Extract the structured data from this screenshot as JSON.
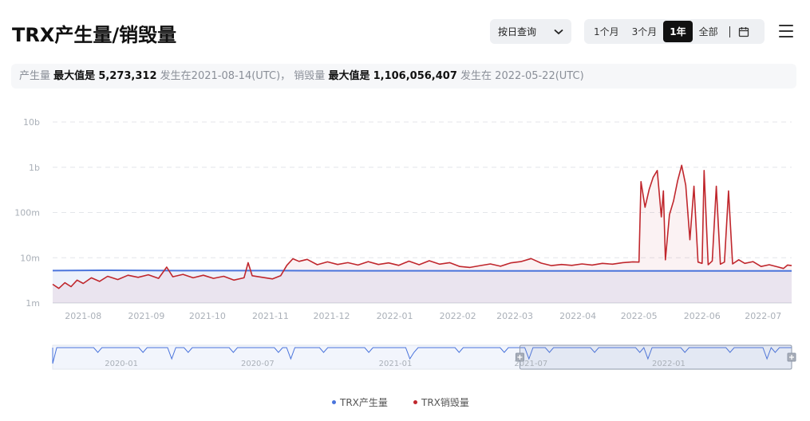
{
  "header": {
    "title": "TRX产生量/销毁量",
    "query_mode": "按日查询",
    "ranges": [
      "1个月",
      "3个月",
      "1年",
      "全部"
    ],
    "active_range": "1年"
  },
  "stats": {
    "prod_label": "产生量",
    "prod_max_label": "最大值是",
    "prod_max": "5,273,312",
    "prod_at": "发生在",
    "prod_date": "2021-08-14(UTC)，",
    "burn_label": "销毁量",
    "burn_max_label": "最大值是",
    "burn_max": "1,106,056,407",
    "burn_at": "发生在",
    "burn_date": "2022-05-22(UTC)"
  },
  "colors": {
    "production": "#4a74dc",
    "burn": "#c0272d",
    "grid": "#e4e6ea",
    "axis_text": "#aab0b8"
  },
  "chart_data": {
    "type": "line",
    "x_start": "2021-07-17",
    "x_end": "2022-07-15",
    "yscale": "log",
    "ylim": [
      1000000,
      10000000000
    ],
    "y_ticks": [
      {
        "value": 1000000,
        "label": "1m"
      },
      {
        "value": 10000000,
        "label": "10m"
      },
      {
        "value": 100000000,
        "label": "100m"
      },
      {
        "value": 1000000000,
        "label": "1b"
      },
      {
        "value": 10000000000,
        "label": "10b"
      }
    ],
    "x_ticks": [
      {
        "date": "2021-08-01",
        "label": "2021-08"
      },
      {
        "date": "2021-09-01",
        "label": "2021-09"
      },
      {
        "date": "2021-10-01",
        "label": "2021-10"
      },
      {
        "date": "2021-11-01",
        "label": "2021-11"
      },
      {
        "date": "2021-12-01",
        "label": "2021-12"
      },
      {
        "date": "2022-01-01",
        "label": "2022-01"
      },
      {
        "date": "2022-02-01",
        "label": "2022-02"
      },
      {
        "date": "2022-03-01",
        "label": "2022-03"
      },
      {
        "date": "2022-04-01",
        "label": "2022-04"
      },
      {
        "date": "2022-05-01",
        "label": "2022-05"
      },
      {
        "date": "2022-06-01",
        "label": "2022-06"
      },
      {
        "date": "2022-07-01",
        "label": "2022-07"
      }
    ],
    "grid": true,
    "legend_position": "bottom-center",
    "series": [
      {
        "name": "TRX产生量",
        "key": "production",
        "points": [
          [
            "2021-07-17",
            5200000
          ],
          [
            "2021-08-14",
            5273312
          ],
          [
            "2021-09-15",
            5200000
          ],
          [
            "2021-10-20",
            5200000
          ],
          [
            "2021-11-05",
            5200000
          ],
          [
            "2021-12-15",
            5150000
          ],
          [
            "2022-01-20",
            5150000
          ],
          [
            "2022-03-01",
            5100000
          ],
          [
            "2022-04-15",
            5100000
          ],
          [
            "2022-05-20",
            5100000
          ],
          [
            "2022-06-20",
            5100000
          ],
          [
            "2022-07-15",
            5100000
          ]
        ]
      },
      {
        "name": "TRX销毁量",
        "key": "burn",
        "points": [
          [
            "2021-07-17",
            2600000
          ],
          [
            "2021-07-20",
            2100000
          ],
          [
            "2021-07-23",
            2800000
          ],
          [
            "2021-07-26",
            2300000
          ],
          [
            "2021-07-29",
            3200000
          ],
          [
            "2021-08-01",
            2700000
          ],
          [
            "2021-08-05",
            3600000
          ],
          [
            "2021-08-09",
            3000000
          ],
          [
            "2021-08-13",
            3900000
          ],
          [
            "2021-08-18",
            3300000
          ],
          [
            "2021-08-23",
            4100000
          ],
          [
            "2021-08-28",
            3700000
          ],
          [
            "2021-09-02",
            4200000
          ],
          [
            "2021-09-07",
            3500000
          ],
          [
            "2021-09-11",
            6200000
          ],
          [
            "2021-09-14",
            3800000
          ],
          [
            "2021-09-19",
            4300000
          ],
          [
            "2021-09-24",
            3600000
          ],
          [
            "2021-09-29",
            4100000
          ],
          [
            "2021-10-04",
            3500000
          ],
          [
            "2021-10-09",
            3900000
          ],
          [
            "2021-10-14",
            3200000
          ],
          [
            "2021-10-19",
            3600000
          ],
          [
            "2021-10-21",
            7800000
          ],
          [
            "2021-10-23",
            4000000
          ],
          [
            "2021-10-28",
            3700000
          ],
          [
            "2021-11-02",
            3400000
          ],
          [
            "2021-11-06",
            4000000
          ],
          [
            "2021-11-09",
            6800000
          ],
          [
            "2021-11-12",
            9500000
          ],
          [
            "2021-11-15",
            8300000
          ],
          [
            "2021-11-19",
            9200000
          ],
          [
            "2021-11-24",
            7000000
          ],
          [
            "2021-11-29",
            8100000
          ],
          [
            "2021-12-04",
            7100000
          ],
          [
            "2021-12-09",
            7800000
          ],
          [
            "2021-12-14",
            6900000
          ],
          [
            "2021-12-19",
            8200000
          ],
          [
            "2021-12-24",
            7100000
          ],
          [
            "2021-12-29",
            7700000
          ],
          [
            "2022-01-03",
            6800000
          ],
          [
            "2022-01-08",
            8400000
          ],
          [
            "2022-01-13",
            7000000
          ],
          [
            "2022-01-18",
            8600000
          ],
          [
            "2022-01-23",
            7200000
          ],
          [
            "2022-01-28",
            7800000
          ],
          [
            "2022-02-02",
            6400000
          ],
          [
            "2022-02-07",
            6100000
          ],
          [
            "2022-02-12",
            6700000
          ],
          [
            "2022-02-17",
            7300000
          ],
          [
            "2022-02-22",
            6500000
          ],
          [
            "2022-02-27",
            7700000
          ],
          [
            "2022-03-04",
            8200000
          ],
          [
            "2022-03-09",
            9600000
          ],
          [
            "2022-03-14",
            7600000
          ],
          [
            "2022-03-19",
            6700000
          ],
          [
            "2022-03-24",
            7100000
          ],
          [
            "2022-03-29",
            6800000
          ],
          [
            "2022-04-03",
            7300000
          ],
          [
            "2022-04-08",
            6900000
          ],
          [
            "2022-04-13",
            7500000
          ],
          [
            "2022-04-18",
            7200000
          ],
          [
            "2022-04-23",
            7800000
          ],
          [
            "2022-04-28",
            8100000
          ],
          [
            "2022-05-01",
            8000000
          ],
          [
            "2022-05-02",
            480000000
          ],
          [
            "2022-05-04",
            130000000
          ],
          [
            "2022-05-06",
            320000000
          ],
          [
            "2022-05-08",
            600000000
          ],
          [
            "2022-05-10",
            850000000
          ],
          [
            "2022-05-12",
            80000000
          ],
          [
            "2022-05-13",
            300000000
          ],
          [
            "2022-05-14",
            9000000
          ],
          [
            "2022-05-16",
            90000000
          ],
          [
            "2022-05-18",
            180000000
          ],
          [
            "2022-05-20",
            500000000
          ],
          [
            "2022-05-22",
            1106056407
          ],
          [
            "2022-05-24",
            400000000
          ],
          [
            "2022-05-26",
            25000000
          ],
          [
            "2022-05-28",
            380000000
          ],
          [
            "2022-05-30",
            8000000
          ],
          [
            "2022-06-01",
            7500000
          ],
          [
            "2022-06-02",
            850000000
          ],
          [
            "2022-06-04",
            7000000
          ],
          [
            "2022-06-06",
            8500000
          ],
          [
            "2022-06-08",
            380000000
          ],
          [
            "2022-06-10",
            7200000
          ],
          [
            "2022-06-12",
            8000000
          ],
          [
            "2022-06-14",
            300000000
          ],
          [
            "2022-06-16",
            7300000
          ],
          [
            "2022-06-19",
            9000000
          ],
          [
            "2022-06-22",
            7500000
          ],
          [
            "2022-06-26",
            8200000
          ],
          [
            "2022-06-30",
            6400000
          ],
          [
            "2022-07-04",
            7000000
          ],
          [
            "2022-07-08",
            6300000
          ],
          [
            "2022-07-11",
            5800000
          ],
          [
            "2022-07-13",
            6900000
          ],
          [
            "2022-07-15",
            6700000
          ]
        ]
      }
    ]
  },
  "zoom": {
    "ticks": [
      {
        "date": "2020-01-01",
        "label": "2020-01"
      },
      {
        "date": "2020-07-01",
        "label": "2020-07"
      },
      {
        "date": "2021-01-01",
        "label": "2021-01"
      },
      {
        "date": "2021-07-01",
        "label": "2021-07"
      },
      {
        "date": "2022-01-01",
        "label": "2022-01"
      }
    ],
    "selected_range": [
      "2021-07-17",
      "2022-07-15"
    ]
  }
}
